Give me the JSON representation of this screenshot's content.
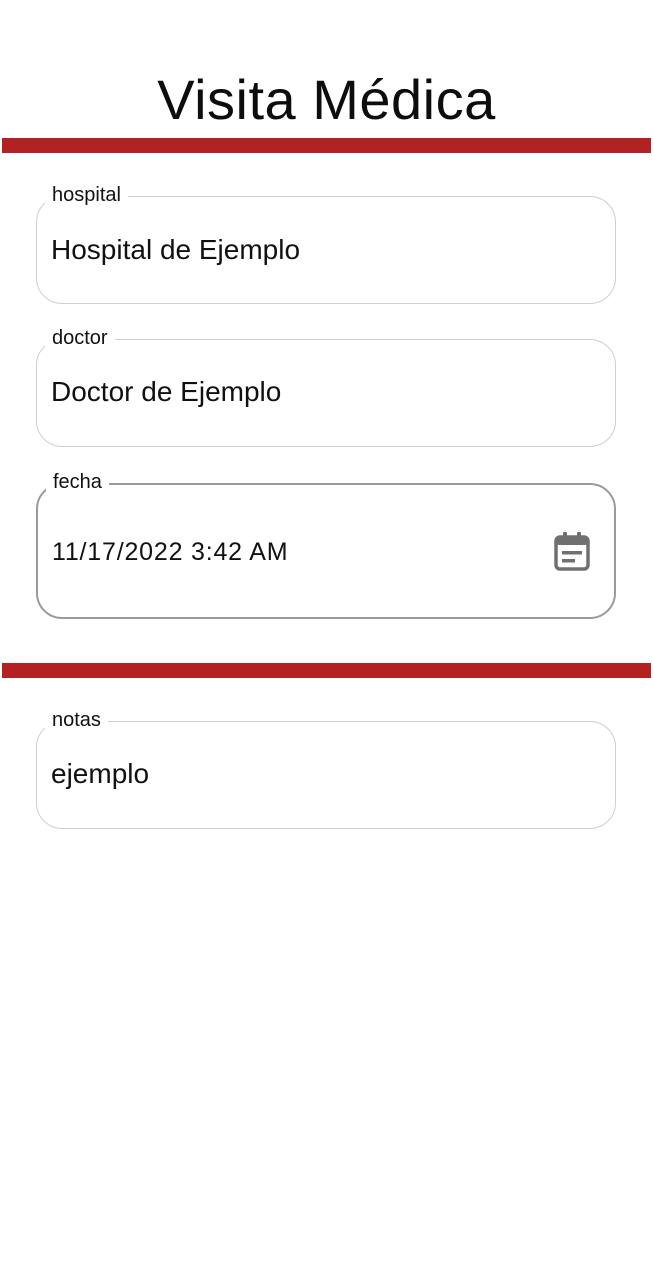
{
  "header": {
    "title": "Visita Médica"
  },
  "colors": {
    "divider": "#b22222",
    "icon": "#707070"
  },
  "form": {
    "hospital": {
      "label": "hospital",
      "value": "Hospital de Ejemplo"
    },
    "doctor": {
      "label": "doctor",
      "value": "Doctor de Ejemplo"
    },
    "fecha": {
      "label": "fecha",
      "value": "11/17/2022 3:42 AM",
      "icon": "calendar-icon"
    },
    "notas": {
      "label": "notas",
      "value": "ejemplo"
    }
  }
}
